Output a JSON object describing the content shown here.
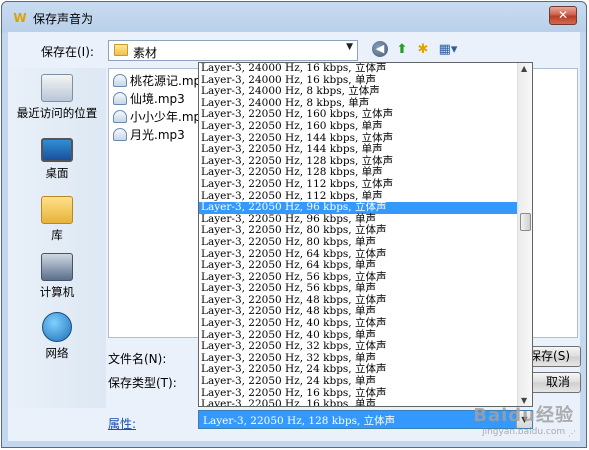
{
  "window": {
    "title": "保存声音为"
  },
  "toolbar": {
    "save_in_label": "保存在(I):",
    "current_folder": "素材"
  },
  "places": [
    {
      "label": "最近访问的位置",
      "icon": "recent-places-icon"
    },
    {
      "label": "桌面",
      "icon": "desktop-icon"
    },
    {
      "label": "库",
      "icon": "library-icon"
    },
    {
      "label": "计算机",
      "icon": "computer-icon"
    },
    {
      "label": "网络",
      "icon": "network-icon"
    }
  ],
  "files": [
    "桃花源记.mp3",
    "仙境.mp3",
    "小小少年.mp3",
    "月光.mp3"
  ],
  "form": {
    "filename_label": "文件名(N):",
    "filetype_label": "保存类型(T):",
    "attributes_link": "属性:",
    "save_button": "保存(S)",
    "cancel_button": "取消"
  },
  "format_options": [
    "Layer-3, 24000 Hz, 16 kbps, 立体声",
    "Layer-3, 24000 Hz, 16 kbps, 单声",
    "Layer-3, 24000 Hz, 8 kbps, 立体声",
    "Layer-3, 24000 Hz, 8 kbps, 单声",
    "Layer-3, 22050 Hz, 160 kbps, 立体声",
    "Layer-3, 22050 Hz, 160 kbps, 单声",
    "Layer-3, 22050 Hz, 144 kbps, 立体声",
    "Layer-3, 22050 Hz, 144 kbps, 单声",
    "Layer-3, 22050 Hz, 128 kbps, 立体声",
    "Layer-3, 22050 Hz, 128 kbps, 单声",
    "Layer-3, 22050 Hz, 112 kbps, 立体声",
    "Layer-3, 22050 Hz, 112 kbps, 单声",
    "Layer-3, 22050 Hz, 96 kbps, 立体声",
    "Layer-3, 22050 Hz, 96 kbps, 单声",
    "Layer-3, 22050 Hz, 80 kbps, 立体声",
    "Layer-3, 22050 Hz, 80 kbps, 单声",
    "Layer-3, 22050 Hz, 64 kbps, 立体声",
    "Layer-3, 22050 Hz, 64 kbps, 单声",
    "Layer-3, 22050 Hz, 56 kbps, 立体声",
    "Layer-3, 22050 Hz, 56 kbps, 单声",
    "Layer-3, 22050 Hz, 48 kbps, 立体声",
    "Layer-3, 22050 Hz, 48 kbps, 单声",
    "Layer-3, 22050 Hz, 40 kbps, 立体声",
    "Layer-3, 22050 Hz, 40 kbps, 单声",
    "Layer-3, 22050 Hz, 32 kbps, 立体声",
    "Layer-3, 22050 Hz, 32 kbps, 单声",
    "Layer-3, 22050 Hz, 24 kbps, 立体声",
    "Layer-3, 22050 Hz, 24 kbps, 单声",
    "Layer-3, 22050 Hz, 16 kbps, 立体声",
    "Layer-3, 22050 Hz, 16 kbps, 单声"
  ],
  "highlighted_option": "Layer-3, 22050 Hz, 96 kbps, 立体声",
  "selected_format": "Layer-3, 22050 Hz, 128 kbps, 立体声",
  "watermark": {
    "brand": "Baidu经验",
    "url": "jingyan.baidu.com"
  },
  "colors": {
    "selection": "#3399ff",
    "window_frame": "#b9d0ea",
    "close_button": "#c8452f"
  }
}
